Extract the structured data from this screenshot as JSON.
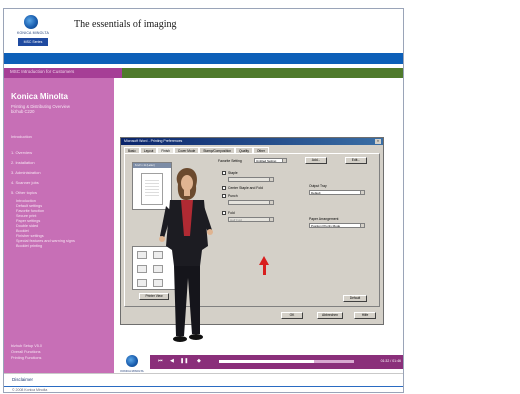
{
  "header": {
    "title": "The essentials of imaging",
    "logo_text": "KONICA MINOLTA",
    "logo_badge": "MSC Series"
  },
  "nav": {
    "breadcrumb": "MSC Introduction for Customers"
  },
  "sidebar": {
    "title": "Konica Minolta",
    "subtitle": "Printing & Distributing Overview",
    "subtitle2": "bizhub C220",
    "intro": "Introduction",
    "items": [
      "1. Overview",
      "2. Installation",
      "3. Administration",
      "4. Scanner jobs",
      "5. Other topics"
    ],
    "sub_items": [
      "Introduction",
      "Default settings",
      "Favorite function",
      "Secure print",
      "Paper settings",
      "Double sided",
      "Booklet",
      "Finisher settings",
      "Special features and warning signs",
      "Booklet printing"
    ],
    "footer": [
      "bizhub Setup V5.0",
      "Overall Functions",
      "Printing Functions"
    ]
  },
  "dialog": {
    "title": "Microsoft Word - Printing Preferences",
    "tabs": [
      "Basic",
      "Layout",
      "Finish",
      "Cover Mode",
      "Stamp/Composition",
      "Quality",
      "Other"
    ],
    "active_tab": "Finish",
    "favorite_label": "Favorite Setting",
    "favorite_value": "Untitled Setting",
    "add_button": "Add...",
    "edit_button": "Edit...",
    "options": [
      "Staple",
      "Center Staple and Fold",
      "Punch",
      "Fold",
      "Half Fold"
    ],
    "output_tray_label": "Output Tray",
    "output_tray_value": "Default",
    "paper_arrangement_label": "Paper Arrangement",
    "paper_arrangement_value": "Position Priority Mode",
    "printer_view": "Printer View",
    "default_button": "Default",
    "ok_button": "OK",
    "cancel_button": "Abbrechen",
    "help_button": "Hilfe",
    "preview_header": "8-1/2 x 11 (Letter)"
  },
  "player": {
    "time": "01:32 / 01:46",
    "progress": 0.7
  },
  "footer": {
    "label": "Disclaimer",
    "copyright": "© 2008 Konica Minolta"
  },
  "colors": {
    "brand_blue": "#0d5fb8",
    "sidebar_purple": "#c76fb6",
    "nav_green": "#4f7a2c",
    "arrow_red": "#d81e1e"
  }
}
